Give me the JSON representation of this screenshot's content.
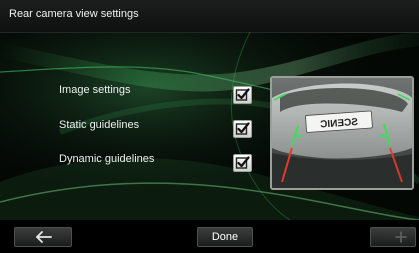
{
  "header": {
    "title": "Rear camera view settings"
  },
  "settings": [
    {
      "label": "Image settings",
      "checked": true
    },
    {
      "label": "Static guidelines",
      "checked": true
    },
    {
      "label": "Dynamic guidelines",
      "checked": true
    }
  ],
  "preview": {
    "plate_text": "SCENIC"
  },
  "footer": {
    "back_icon": "back-arrow-icon",
    "done_label": "Done",
    "add_icon": "plus-icon"
  },
  "colors": {
    "swoosh_green": "#3fae5a",
    "guideline_green": "#3ddc5a",
    "guideline_red": "#e23b2b"
  }
}
